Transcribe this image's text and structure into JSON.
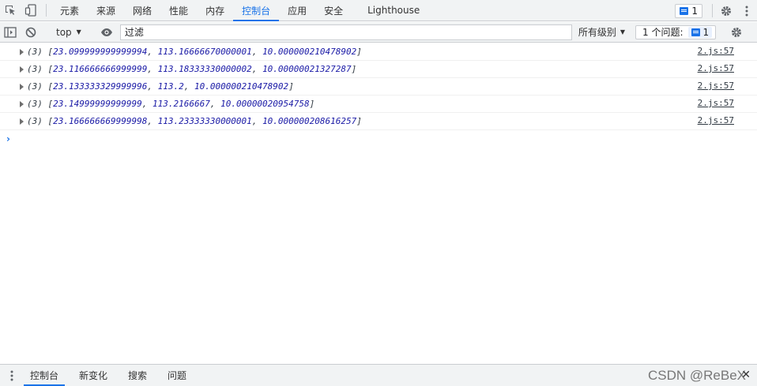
{
  "tabbar": {
    "tabs": [
      "元素",
      "来源",
      "网络",
      "性能",
      "内存",
      "控制台",
      "应用",
      "安全",
      "Lighthouse"
    ],
    "active_index": 5,
    "issue_badge_count": "1"
  },
  "toolbar": {
    "context": "top",
    "filter_placeholder": "过滤",
    "levels": "所有级别",
    "issues_label": "1 个问题:",
    "issues_count": "1"
  },
  "console": {
    "messages": [
      {
        "count": "(3)",
        "values": [
          "23.099999999999994",
          "113.16666670000001",
          "10.000000210478902"
        ],
        "source": "2.js:57"
      },
      {
        "count": "(3)",
        "values": [
          "23.116666666999999",
          "113.18333330000002",
          "10.00000021327287"
        ],
        "source": "2.js:57"
      },
      {
        "count": "(3)",
        "values": [
          "23.133333329999996",
          "113.2",
          "10.000000210478902"
        ],
        "source": "2.js:57"
      },
      {
        "count": "(3)",
        "values": [
          "23.14999999999999",
          "113.2166667",
          "10.00000020954758"
        ],
        "source": "2.js:57"
      },
      {
        "count": "(3)",
        "values": [
          "23.166666669999998",
          "113.23333330000001",
          "10.000000208616257"
        ],
        "source": "2.js:57"
      }
    ],
    "prompt_symbol": "›"
  },
  "drawer": {
    "tabs": [
      "控制台",
      "新变化",
      "搜索",
      "问题"
    ],
    "active_index": 0,
    "watermark": "CSDN @ReBeX"
  },
  "colors": {
    "accent": "#1a73e8",
    "number": "#1a1aa6",
    "bar_bg": "#f1f3f4"
  },
  "icons": [
    "inspect-icon",
    "device-toolbar-icon",
    "gear-icon",
    "kebab-menu-icon",
    "sidebar-toggle-icon",
    "clear-console-icon",
    "eye-icon",
    "close-icon"
  ]
}
